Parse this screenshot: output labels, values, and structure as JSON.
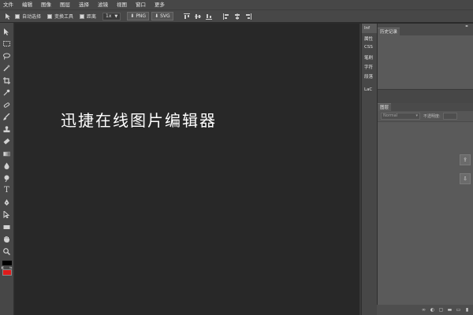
{
  "menu": [
    "文件",
    "编辑",
    "图像",
    "图层",
    "选择",
    "滤镜",
    "视图",
    "窗口",
    "更多"
  ],
  "options": {
    "auto_select": "自动选择",
    "transform_tools": "变换工具",
    "distance": "距离",
    "zoom": "1x",
    "export_png": "PNG",
    "export_svg": "SVG"
  },
  "canvas": {
    "banner_text": "迅捷在线图片编辑器",
    "background": "#282828"
  },
  "right_tabs": [
    "Inf",
    "属性",
    "CSS",
    "笔刷",
    "字符",
    "段落",
    "LaC"
  ],
  "panels": {
    "history_tab": "历史记录",
    "layers_tab": "图层",
    "blend_mode": "Normal",
    "opacity_label": "不透明度:"
  },
  "colors": {
    "foreground": "#000000",
    "background": "#e01b1b"
  },
  "icons": {
    "tools": [
      "move-icon",
      "marquee-icon",
      "lasso-icon",
      "magic-wand-icon",
      "crop-icon",
      "eyedropper-icon",
      "healing-icon",
      "brush-icon",
      "stamp-icon",
      "eraser-icon",
      "gradient-icon",
      "blur-icon",
      "dodge-icon",
      "text-icon",
      "pen-icon",
      "path-select-icon",
      "shape-icon",
      "hand-icon",
      "zoom-icon"
    ]
  }
}
